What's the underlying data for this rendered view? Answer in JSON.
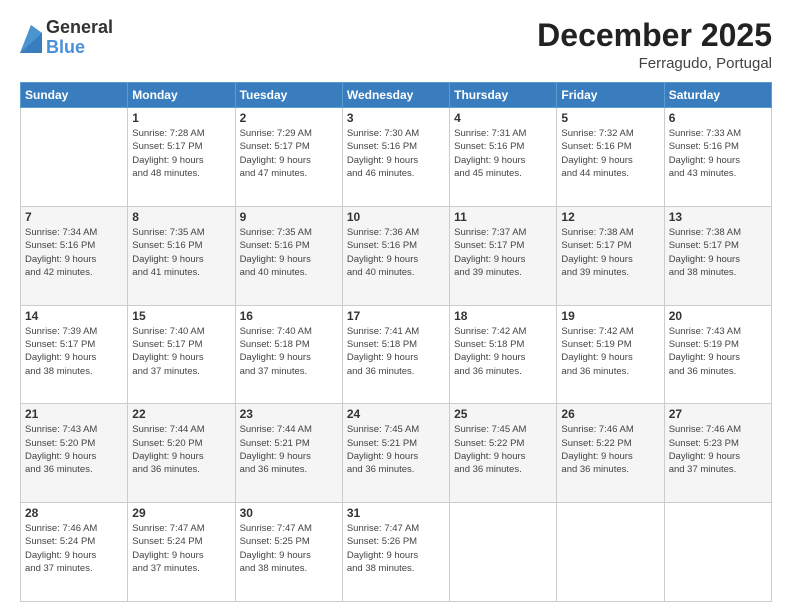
{
  "logo": {
    "general": "General",
    "blue": "Blue"
  },
  "title": {
    "month": "December 2025",
    "location": "Ferragudo, Portugal"
  },
  "days_of_week": [
    "Sunday",
    "Monday",
    "Tuesday",
    "Wednesday",
    "Thursday",
    "Friday",
    "Saturday"
  ],
  "weeks": [
    [
      {
        "day": "",
        "sunrise": "",
        "sunset": "",
        "daylight": ""
      },
      {
        "day": "1",
        "sunrise": "Sunrise: 7:28 AM",
        "sunset": "Sunset: 5:17 PM",
        "daylight": "Daylight: 9 hours and 48 minutes."
      },
      {
        "day": "2",
        "sunrise": "Sunrise: 7:29 AM",
        "sunset": "Sunset: 5:17 PM",
        "daylight": "Daylight: 9 hours and 47 minutes."
      },
      {
        "day": "3",
        "sunrise": "Sunrise: 7:30 AM",
        "sunset": "Sunset: 5:16 PM",
        "daylight": "Daylight: 9 hours and 46 minutes."
      },
      {
        "day": "4",
        "sunrise": "Sunrise: 7:31 AM",
        "sunset": "Sunset: 5:16 PM",
        "daylight": "Daylight: 9 hours and 45 minutes."
      },
      {
        "day": "5",
        "sunrise": "Sunrise: 7:32 AM",
        "sunset": "Sunset: 5:16 PM",
        "daylight": "Daylight: 9 hours and 44 minutes."
      },
      {
        "day": "6",
        "sunrise": "Sunrise: 7:33 AM",
        "sunset": "Sunset: 5:16 PM",
        "daylight": "Daylight: 9 hours and 43 minutes."
      }
    ],
    [
      {
        "day": "7",
        "sunrise": "Sunrise: 7:34 AM",
        "sunset": "Sunset: 5:16 PM",
        "daylight": "Daylight: 9 hours and 42 minutes."
      },
      {
        "day": "8",
        "sunrise": "Sunrise: 7:35 AM",
        "sunset": "Sunset: 5:16 PM",
        "daylight": "Daylight: 9 hours and 41 minutes."
      },
      {
        "day": "9",
        "sunrise": "Sunrise: 7:35 AM",
        "sunset": "Sunset: 5:16 PM",
        "daylight": "Daylight: 9 hours and 40 minutes."
      },
      {
        "day": "10",
        "sunrise": "Sunrise: 7:36 AM",
        "sunset": "Sunset: 5:16 PM",
        "daylight": "Daylight: 9 hours and 40 minutes."
      },
      {
        "day": "11",
        "sunrise": "Sunrise: 7:37 AM",
        "sunset": "Sunset: 5:17 PM",
        "daylight": "Daylight: 9 hours and 39 minutes."
      },
      {
        "day": "12",
        "sunrise": "Sunrise: 7:38 AM",
        "sunset": "Sunset: 5:17 PM",
        "daylight": "Daylight: 9 hours and 39 minutes."
      },
      {
        "day": "13",
        "sunrise": "Sunrise: 7:38 AM",
        "sunset": "Sunset: 5:17 PM",
        "daylight": "Daylight: 9 hours and 38 minutes."
      }
    ],
    [
      {
        "day": "14",
        "sunrise": "Sunrise: 7:39 AM",
        "sunset": "Sunset: 5:17 PM",
        "daylight": "Daylight: 9 hours and 38 minutes."
      },
      {
        "day": "15",
        "sunrise": "Sunrise: 7:40 AM",
        "sunset": "Sunset: 5:17 PM",
        "daylight": "Daylight: 9 hours and 37 minutes."
      },
      {
        "day": "16",
        "sunrise": "Sunrise: 7:40 AM",
        "sunset": "Sunset: 5:18 PM",
        "daylight": "Daylight: 9 hours and 37 minutes."
      },
      {
        "day": "17",
        "sunrise": "Sunrise: 7:41 AM",
        "sunset": "Sunset: 5:18 PM",
        "daylight": "Daylight: 9 hours and 36 minutes."
      },
      {
        "day": "18",
        "sunrise": "Sunrise: 7:42 AM",
        "sunset": "Sunset: 5:18 PM",
        "daylight": "Daylight: 9 hours and 36 minutes."
      },
      {
        "day": "19",
        "sunrise": "Sunrise: 7:42 AM",
        "sunset": "Sunset: 5:19 PM",
        "daylight": "Daylight: 9 hours and 36 minutes."
      },
      {
        "day": "20",
        "sunrise": "Sunrise: 7:43 AM",
        "sunset": "Sunset: 5:19 PM",
        "daylight": "Daylight: 9 hours and 36 minutes."
      }
    ],
    [
      {
        "day": "21",
        "sunrise": "Sunrise: 7:43 AM",
        "sunset": "Sunset: 5:20 PM",
        "daylight": "Daylight: 9 hours and 36 minutes."
      },
      {
        "day": "22",
        "sunrise": "Sunrise: 7:44 AM",
        "sunset": "Sunset: 5:20 PM",
        "daylight": "Daylight: 9 hours and 36 minutes."
      },
      {
        "day": "23",
        "sunrise": "Sunrise: 7:44 AM",
        "sunset": "Sunset: 5:21 PM",
        "daylight": "Daylight: 9 hours and 36 minutes."
      },
      {
        "day": "24",
        "sunrise": "Sunrise: 7:45 AM",
        "sunset": "Sunset: 5:21 PM",
        "daylight": "Daylight: 9 hours and 36 minutes."
      },
      {
        "day": "25",
        "sunrise": "Sunrise: 7:45 AM",
        "sunset": "Sunset: 5:22 PM",
        "daylight": "Daylight: 9 hours and 36 minutes."
      },
      {
        "day": "26",
        "sunrise": "Sunrise: 7:46 AM",
        "sunset": "Sunset: 5:22 PM",
        "daylight": "Daylight: 9 hours and 36 minutes."
      },
      {
        "day": "27",
        "sunrise": "Sunrise: 7:46 AM",
        "sunset": "Sunset: 5:23 PM",
        "daylight": "Daylight: 9 hours and 37 minutes."
      }
    ],
    [
      {
        "day": "28",
        "sunrise": "Sunrise: 7:46 AM",
        "sunset": "Sunset: 5:24 PM",
        "daylight": "Daylight: 9 hours and 37 minutes."
      },
      {
        "day": "29",
        "sunrise": "Sunrise: 7:47 AM",
        "sunset": "Sunset: 5:24 PM",
        "daylight": "Daylight: 9 hours and 37 minutes."
      },
      {
        "day": "30",
        "sunrise": "Sunrise: 7:47 AM",
        "sunset": "Sunset: 5:25 PM",
        "daylight": "Daylight: 9 hours and 38 minutes."
      },
      {
        "day": "31",
        "sunrise": "Sunrise: 7:47 AM",
        "sunset": "Sunset: 5:26 PM",
        "daylight": "Daylight: 9 hours and 38 minutes."
      },
      {
        "day": "",
        "sunrise": "",
        "sunset": "",
        "daylight": ""
      },
      {
        "day": "",
        "sunrise": "",
        "sunset": "",
        "daylight": ""
      },
      {
        "day": "",
        "sunrise": "",
        "sunset": "",
        "daylight": ""
      }
    ]
  ]
}
